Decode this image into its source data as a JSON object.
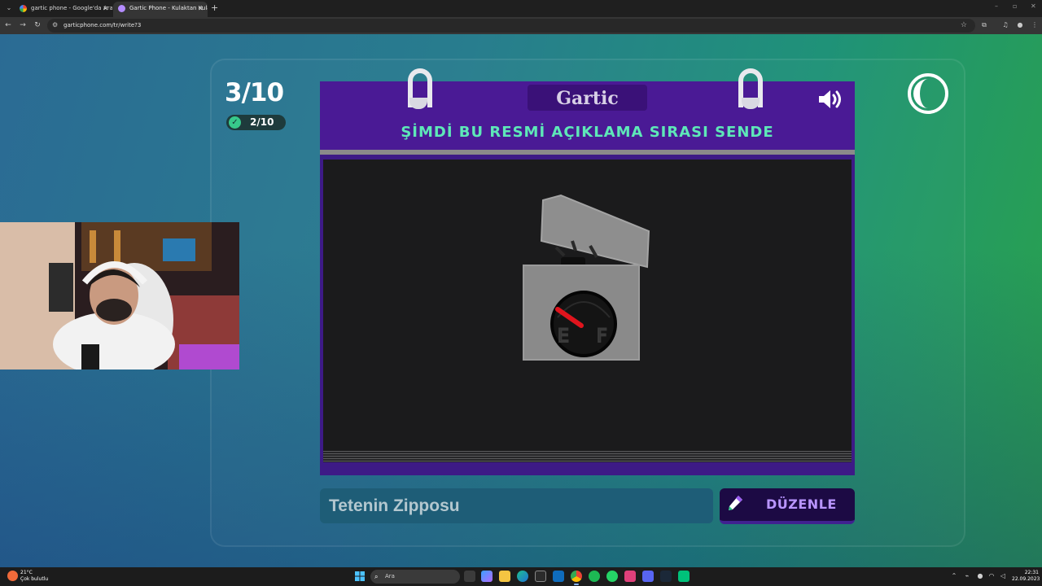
{
  "browser": {
    "tabs": [
      {
        "title": "gartic phone - Google'da Ara",
        "active": false
      },
      {
        "title": "Gartic Phone - Kulaktan Kulağa",
        "active": true
      }
    ],
    "url": "garticphone.com/tr/write?3"
  },
  "game": {
    "logo": "Gartic",
    "round": "3/10",
    "done_count": "2/10",
    "prompt": "ŞİMDİ BU RESMİ AÇIKLAMA SIRASI SENDE",
    "answer_value": "Tetenin Zipposu",
    "edit_button_label": "DÜZENLE",
    "colors": {
      "notebook": "#4a1a95",
      "prompt_text": "#5ee8b8",
      "canvas": "#1b1b1c",
      "edit_label": "#b995ff"
    },
    "drawing": {
      "description_icon": "lighter-with-fuel-gauge-drawing",
      "gauge_letters": [
        "E",
        "F"
      ]
    }
  },
  "taskbar": {
    "weather_temp": "21°C",
    "weather_condition": "Çok bulutlu",
    "search_placeholder": "Ara",
    "time": "22:31",
    "date": "22.09.2023"
  }
}
